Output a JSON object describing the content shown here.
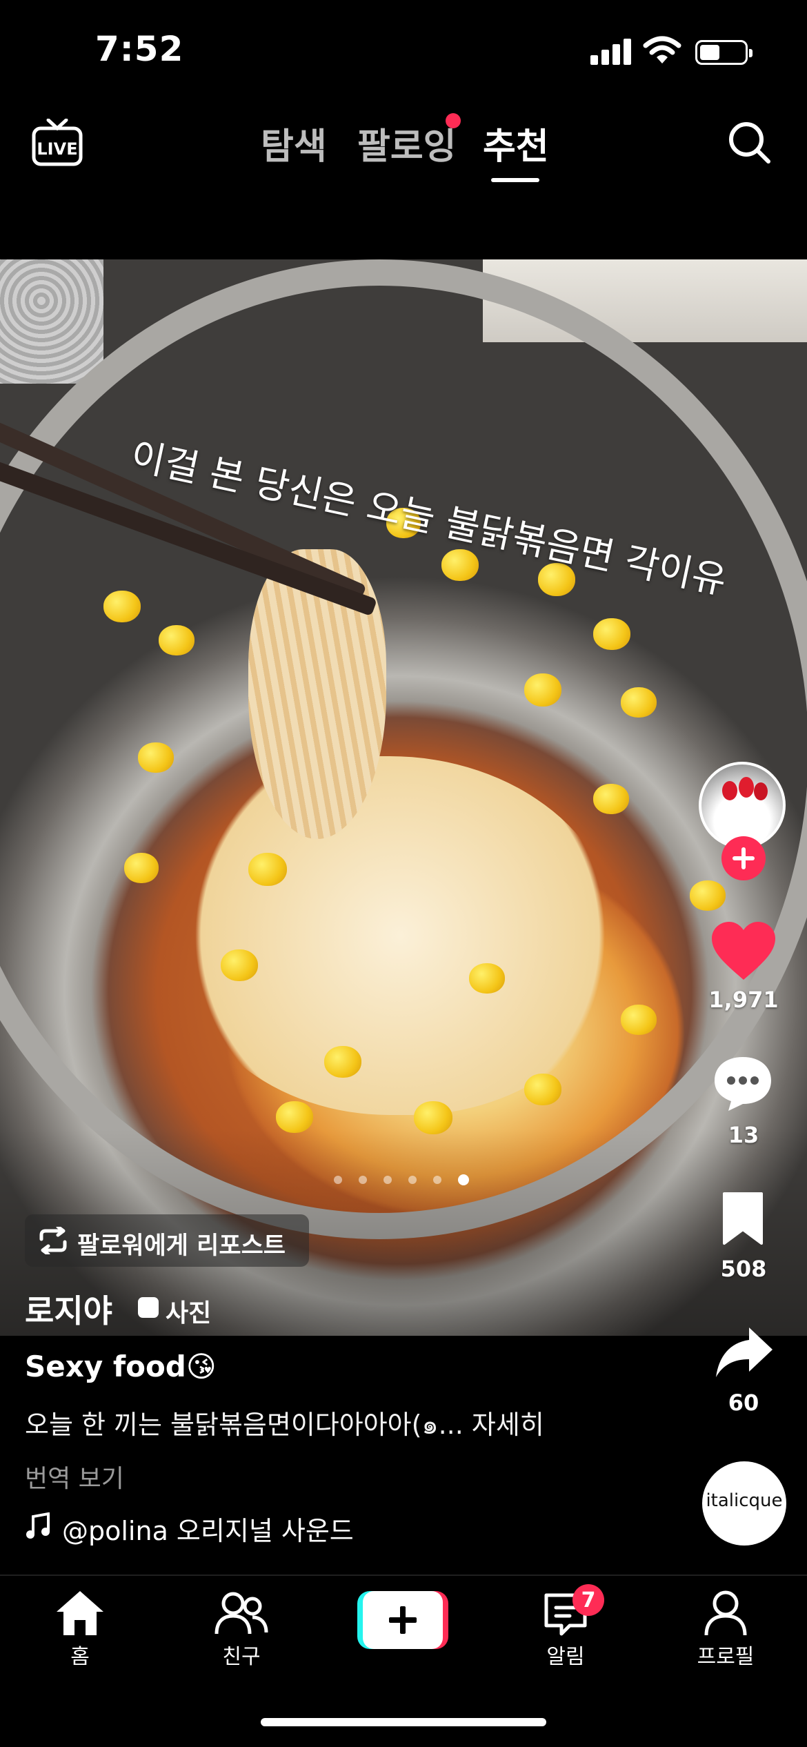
{
  "status_bar": {
    "time": "7:52"
  },
  "top_nav": {
    "tabs": [
      {
        "label": "탐색",
        "active": false
      },
      {
        "label": "팔로잉",
        "active": false,
        "badge_dot": true
      },
      {
        "label": "추천",
        "active": true
      }
    ],
    "live_label": "LIVE"
  },
  "post": {
    "overlay_caption": "이걸 본 당신은 오늘 불닭볶음면 각이유",
    "carousel": {
      "count": 6,
      "active_index": 5
    },
    "repost_label": "팔로워에게 리포스트",
    "author": "로지야",
    "media_type_label": "사진",
    "title": "Sexy food😘",
    "description": "오늘 한 끼는 불닭볶음면이다아아아(๑... 자세히",
    "translate_label": "번역 보기",
    "sound": "@polina 오리지널 사운드",
    "sound_disc_label": "italicque"
  },
  "actions": {
    "likes": "1,971",
    "comments": "13",
    "saves": "508",
    "shares": "60"
  },
  "bottom_nav": {
    "items": [
      {
        "label": "홈"
      },
      {
        "label": "친구"
      },
      {
        "label": ""
      },
      {
        "label": "알림",
        "badge": "7"
      },
      {
        "label": "프로필"
      }
    ]
  },
  "colors": {
    "accent": "#fe2c55",
    "cyan": "#25f4ee",
    "background": "#000000"
  }
}
